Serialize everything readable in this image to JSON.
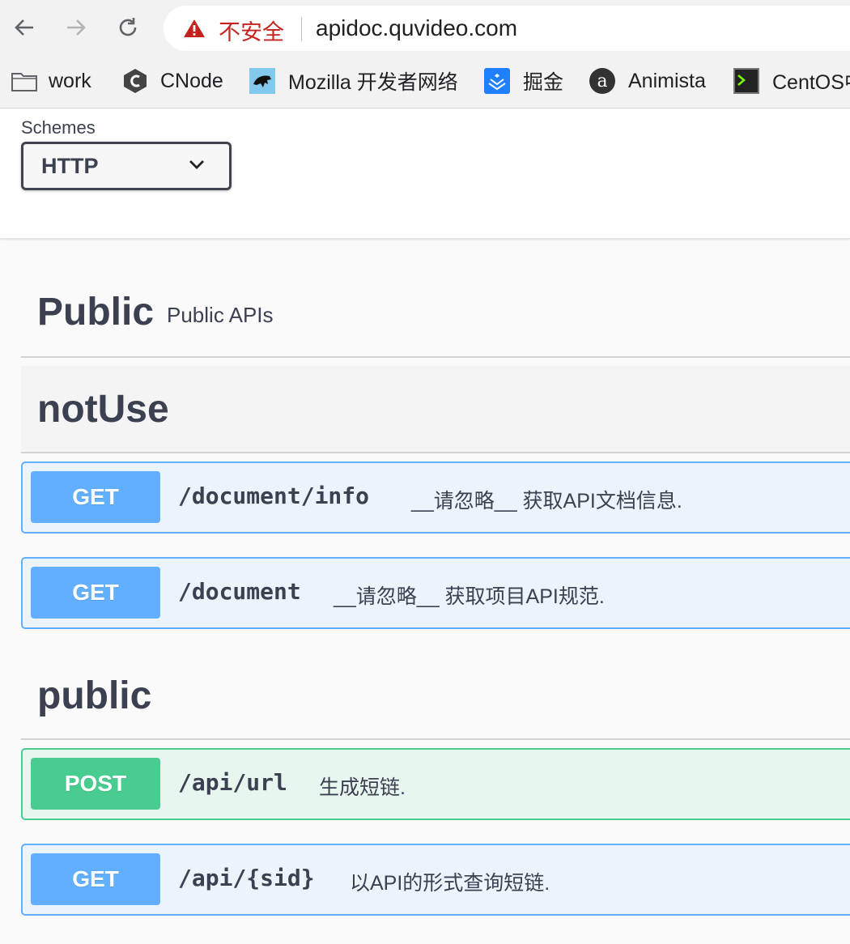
{
  "browser": {
    "security_text": "不安全",
    "url": "apidoc.quvideo.com",
    "bookmarks": [
      {
        "label": "work",
        "icon": "folder-icon"
      },
      {
        "label": "CNode",
        "icon": "cnode-icon"
      },
      {
        "label": "Mozilla 开发者网络",
        "icon": "mdn-icon"
      },
      {
        "label": "掘金",
        "icon": "juejin-icon"
      },
      {
        "label": "Animista",
        "icon": "animista-icon"
      },
      {
        "label": "CentOS中",
        "icon": "terminal-icon"
      }
    ]
  },
  "schemes": {
    "label": "Schemes",
    "selected": "HTTP"
  },
  "tags": [
    {
      "name": "Public",
      "description": "Public APIs"
    },
    {
      "name": "notUse",
      "description": ""
    },
    {
      "name": "public",
      "description": ""
    }
  ],
  "operations": [
    {
      "method": "GET",
      "path": "/document/info",
      "summary": "__请忽略__ 获取API文档信息."
    },
    {
      "method": "GET",
      "path": "/document",
      "summary": "__请忽略__ 获取项目API规范."
    },
    {
      "method": "POST",
      "path": "/api/url",
      "summary": "生成短链."
    },
    {
      "method": "GET",
      "path": "/api/{sid}",
      "summary": "以API的形式查询短链."
    }
  ],
  "colors": {
    "get": "#61affe",
    "post": "#49cc90",
    "insecure": "#c5221f"
  }
}
